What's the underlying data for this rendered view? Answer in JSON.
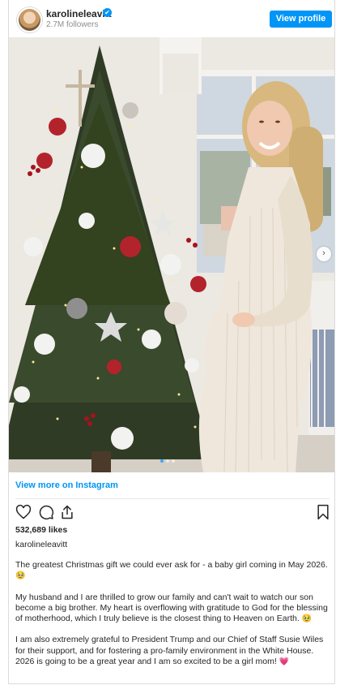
{
  "header": {
    "username": "karolineleavitt",
    "verified_badge": "✔",
    "followers": "2.7M followers",
    "view_profile_label": "View profile"
  },
  "post": {
    "image_description": "",
    "carousel_dots_count": 3,
    "carousel_active_index": 0
  },
  "actions": {
    "view_more_label": "View more on Instagram",
    "likes": "532,689 likes"
  },
  "caption": {
    "username": "karolineleavitt",
    "paragraph_1": "The greatest Christmas gift we could ever ask for - a baby girl coming in May 2026.",
    "paragraph_1_emoji": "🥹",
    "paragraph_2": "My husband and I are thrilled to grow our family and can't wait to watch our son become a big brother. My heart is overflowing with gratitude to God for the blessing of motherhood, which I truly believe is the closest thing to Heaven on Earth.",
    "paragraph_2_emoji": "🥹",
    "paragraph_3": "I am also extremely grateful to President Trump and our Chief of Staff Susie Wiles for their support, and for fostering a pro-family environment in the White House. 2026 is going to be a great year and I am so excited to be a girl mom!",
    "paragraph_3_emoji": "💗"
  },
  "colors": {
    "accent": "#0095f6",
    "text": "#262626",
    "muted": "#8e8e8e"
  }
}
